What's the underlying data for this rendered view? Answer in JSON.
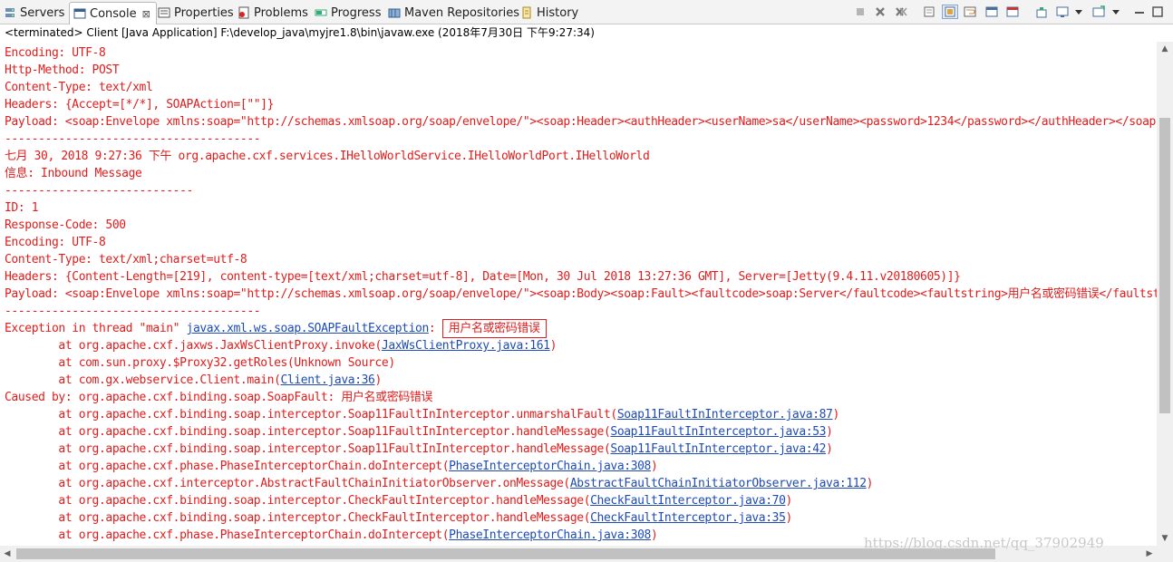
{
  "tabs": [
    {
      "label": "Servers",
      "icon": "servers-icon"
    },
    {
      "label": "Console",
      "icon": "console-icon",
      "active": true,
      "close": "⊠"
    },
    {
      "label": "Properties",
      "icon": "properties-icon"
    },
    {
      "label": "Problems",
      "icon": "problems-icon"
    },
    {
      "label": "Progress",
      "icon": "progress-icon"
    },
    {
      "label": "Maven Repositories",
      "icon": "maven-repositories-icon"
    },
    {
      "label": "History",
      "icon": "history-icon"
    }
  ],
  "toolbar": {
    "icons": [
      "terminate-icon",
      "remove-launch-icon",
      "remove-all-terminated-icon",
      "clear-console-icon",
      "scroll-lock-icon",
      "word-wrap-icon",
      "show-console-on-stdout-icon",
      "show-console-on-stderr-icon",
      "pin-console-icon",
      "display-selected-console-icon",
      "open-console-icon",
      "view-menu-icon",
      "minimize-icon",
      "maximize-icon"
    ]
  },
  "status_text": "<terminated> Client [Java Application] F:\\develop_java\\myjre1.8\\bin\\javaw.exe (2018年7月30日 下午9:27:34)",
  "console": {
    "l1": "Encoding: UTF-8",
    "l2": "Http-Method: POST",
    "l3": "Content-Type: text/xml",
    "l4": "Headers: {Accept=[*/*], SOAPAction=[\"\"]}",
    "l5": "Payload: <soap:Envelope xmlns:soap=\"http://schemas.xmlsoap.org/soap/envelope/\"><soap:Header><authHeader><userName>sa</userName><password>1234</password></authHeader></soap:Header>",
    "l6": "--------------------------------------",
    "l7": "七月 30, 2018 9:27:36 下午 org.apache.cxf.services.IHelloWorldService.IHelloWorldPort.IHelloWorld",
    "l8": "信息: Inbound Message",
    "l9": "----------------------------",
    "l10": "ID: 1",
    "l11": "Response-Code: 500",
    "l12": "Encoding: UTF-8",
    "l13": "Content-Type: text/xml;charset=utf-8",
    "l14": "Headers: {Content-Length=[219], content-type=[text/xml;charset=utf-8], Date=[Mon, 30 Jul 2018 13:27:36 GMT], Server=[Jetty(9.4.11.v20180605)]}",
    "l15": "Payload: <soap:Envelope xmlns:soap=\"http://schemas.xmlsoap.org/soap/envelope/\"><soap:Body><soap:Fault><faultcode>soap:Server</faultcode><faultstring>用户名或密码错误</faultstring>",
    "l16": "--------------------------------------",
    "exception": {
      "prefix": "Exception in thread \"main\" ",
      "link": "javax.xml.ws.soap.SOAPFaultException",
      "sep": ": ",
      "message": "用户名或密码错误"
    },
    "trace1": [
      {
        "text": "        at org.apache.cxf.jaxws.JaxWsClientProxy.invoke(",
        "link": "JaxWsClientProxy.java:161",
        "end": ")"
      },
      {
        "text": "        at com.sun.proxy.$Proxy32.getRoles(Unknown Source)",
        "link": "",
        "end": ""
      },
      {
        "text": "        at com.gx.webservice.Client.main(",
        "link": "Client.java:36",
        "end": ")"
      }
    ],
    "caused_by": "Caused by: org.apache.cxf.binding.soap.SoapFault: 用户名或密码错误",
    "trace2": [
      {
        "text": "        at org.apache.cxf.binding.soap.interceptor.Soap11FaultInInterceptor.unmarshalFault(",
        "link": "Soap11FaultInInterceptor.java:87",
        "end": ")"
      },
      {
        "text": "        at org.apache.cxf.binding.soap.interceptor.Soap11FaultInInterceptor.handleMessage(",
        "link": "Soap11FaultInInterceptor.java:53",
        "end": ")"
      },
      {
        "text": "        at org.apache.cxf.binding.soap.interceptor.Soap11FaultInInterceptor.handleMessage(",
        "link": "Soap11FaultInInterceptor.java:42",
        "end": ")"
      },
      {
        "text": "        at org.apache.cxf.phase.PhaseInterceptorChain.doIntercept(",
        "link": "PhaseInterceptorChain.java:308",
        "end": ")"
      },
      {
        "text": "        at org.apache.cxf.interceptor.AbstractFaultChainInitiatorObserver.onMessage(",
        "link": "AbstractFaultChainInitiatorObserver.java:112",
        "end": ")"
      },
      {
        "text": "        at org.apache.cxf.binding.soap.interceptor.CheckFaultInterceptor.handleMessage(",
        "link": "CheckFaultInterceptor.java:70",
        "end": ")"
      },
      {
        "text": "        at org.apache.cxf.binding.soap.interceptor.CheckFaultInterceptor.handleMessage(",
        "link": "CheckFaultInterceptor.java:35",
        "end": ")"
      },
      {
        "text": "        at org.apache.cxf.phase.PhaseInterceptorChain.doIntercept(",
        "link": "PhaseInterceptorChain.java:308",
        "end": ")"
      }
    ]
  },
  "watermark": "https://blog.csdn.net/qq_37902949",
  "colors": {
    "error_text": "#e01d1d",
    "link": "#1e4bb4"
  }
}
